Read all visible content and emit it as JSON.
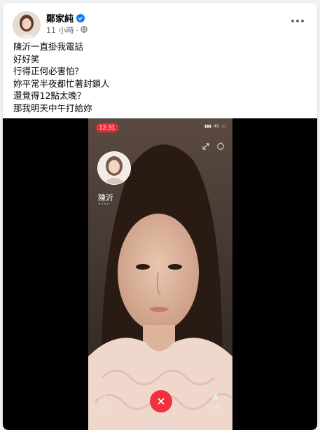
{
  "post": {
    "author": "鄭家純",
    "time": "11 小時",
    "lines": [
      "陳沂一直掛我電話",
      "好好笑",
      "行得正何必害怕？",
      "妳平常半夜都忙著封鎖人",
      "還覺得12點太晚？",
      "那我明天中午打給妳"
    ]
  },
  "call_screen": {
    "clock": "12:31",
    "status": "4G",
    "caller_name": "陳沂",
    "left_control_label": "切換",
    "right_control_label": "美顏"
  },
  "colors": {
    "verified_blue": "#1877f2",
    "end_call_red": "#f0323c",
    "time_pill_red": "#e0303a",
    "online_green": "#4cd964"
  }
}
